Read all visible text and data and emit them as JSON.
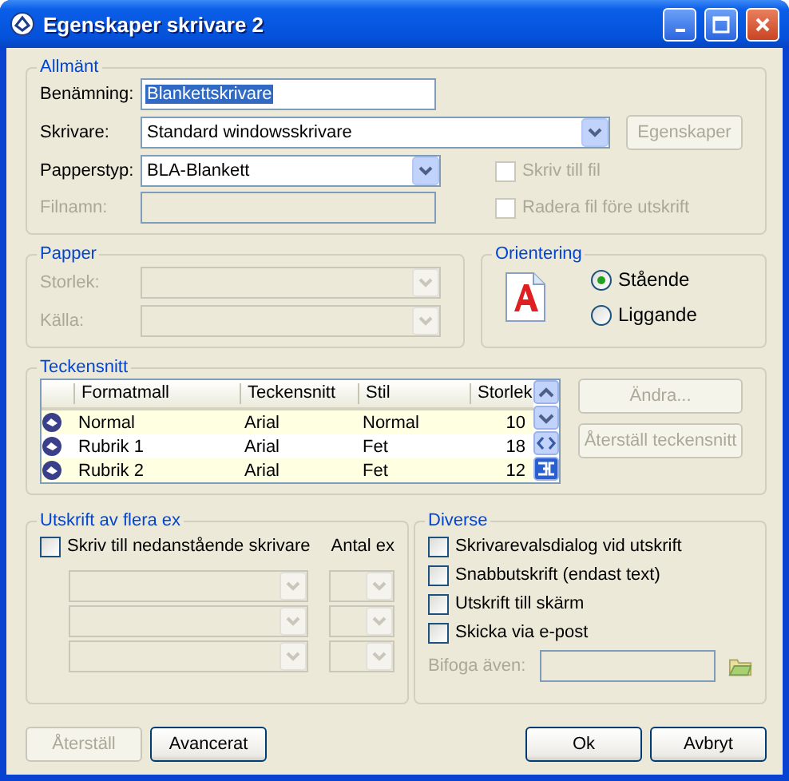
{
  "window": {
    "title": "Egenskaper skrivare 2"
  },
  "general": {
    "legend": "Allmänt",
    "name": {
      "label": "Benämning:",
      "value": "Blankettskrivare",
      "text_selected": true
    },
    "printer": {
      "label": "Skrivare:",
      "value": "Standard windowsskrivare"
    },
    "properties_button": {
      "label": "Egenskaper",
      "disabled": true
    },
    "paper_type": {
      "label": "Papperstyp:",
      "value": "BLA-Blankett"
    },
    "file_name": {
      "label": "Filnamn:",
      "disabled": true
    },
    "checkboxes": [
      {
        "label": "Skriv till fil",
        "checked": false,
        "disabled": true
      },
      {
        "label": "Radera fil före utskrift",
        "checked": false,
        "disabled": true
      }
    ]
  },
  "paper": {
    "legend": "Papper",
    "fields": [
      {
        "label": "Storlek:",
        "disabled": true
      },
      {
        "label": "Källa:",
        "disabled": true
      }
    ]
  },
  "orientation": {
    "legend": "Orientering",
    "options": [
      {
        "label": "Stående",
        "selected": true
      },
      {
        "label": "Liggande",
        "selected": false
      }
    ]
  },
  "fonts": {
    "legend": "Teckensnitt",
    "columns": [
      "Formatmall",
      "Teckensnitt",
      "Stil",
      "Storlek"
    ],
    "rows": [
      {
        "cells": [
          "Normal",
          "Arial",
          "Normal",
          "10"
        ]
      },
      {
        "cells": [
          "Rubrik 1",
          "Arial",
          "Fet",
          "18"
        ]
      },
      {
        "cells": [
          "Rubrik 2",
          "Arial",
          "Fet",
          "12"
        ]
      }
    ],
    "buttons": [
      {
        "label": "Ändra...",
        "disabled": true
      },
      {
        "label": "Återställ teckensnitt",
        "disabled": true
      }
    ]
  },
  "copies": {
    "legend": "Utskrift av flera ex",
    "checkbox": {
      "label": "Skriv till nedanstående skrivare",
      "checked": false
    },
    "count_label": "Antal ex",
    "rows": [
      {
        "disabled": true
      },
      {
        "disabled": true
      },
      {
        "disabled": true
      }
    ]
  },
  "misc": {
    "legend": "Diverse",
    "checkboxes": [
      {
        "label": "Skrivarevalsdialog vid utskrift",
        "checked": false
      },
      {
        "label": "Snabbutskrift (endast text)",
        "checked": false
      },
      {
        "label": "Utskrift till skärm",
        "checked": false
      },
      {
        "label": "Skicka via e-post",
        "checked": false
      }
    ],
    "attach": {
      "label": "Bifoga även:",
      "disabled": true
    }
  },
  "buttons_left": [
    {
      "label": "Återställ",
      "disabled": true
    },
    {
      "label": "Avancerat",
      "disabled": false
    }
  ],
  "buttons_right": [
    {
      "label": "Ok",
      "disabled": false
    },
    {
      "label": "Avbryt",
      "disabled": false
    }
  ]
}
